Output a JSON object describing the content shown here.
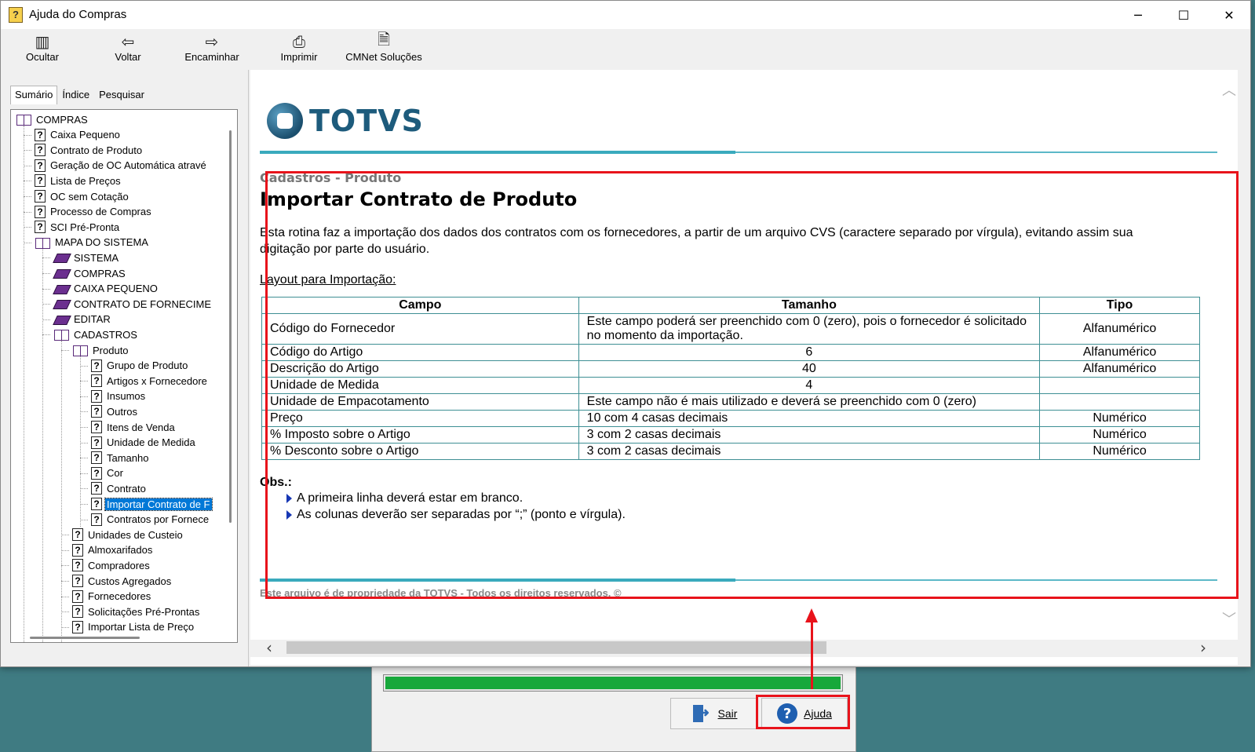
{
  "window": {
    "title": "Ajuda do Compras"
  },
  "window_controls": {
    "minimize": "─",
    "maximize": "☐",
    "close": "✕"
  },
  "toolbar": {
    "hide": "Ocultar",
    "back": "Voltar",
    "forward": "Encaminhar",
    "print": "Imprimir",
    "solutions": "CMNet Soluções"
  },
  "tabs": {
    "summary": "Sumário",
    "index": "Índice",
    "search": "Pesquisar"
  },
  "tree": {
    "root": "COMPRAS",
    "items": [
      "Caixa Pequeno",
      "Contrato de Produto",
      "Geração de OC Automática atravé",
      "Lista de Preços",
      "OC sem Cotação",
      "Processo de Compras",
      "SCI Pré-Pronta"
    ],
    "map": "MAPA DO SISTEMA",
    "map_items": [
      "SISTEMA",
      "COMPRAS",
      "CAIXA PEQUENO",
      "CONTRATO DE FORNECIME",
      "EDITAR"
    ],
    "cadastros": "CADASTROS",
    "produto": "Produto",
    "produto_items": [
      "Grupo de Produto",
      "Artigos x Fornecedore",
      "Insumos",
      "Outros",
      "Itens de Venda",
      "Unidade de Medida",
      "Tamanho",
      "Cor",
      "Contrato",
      "Importar Contrato de F",
      "Contratos por Fornece"
    ],
    "cadastros_items": [
      "Unidades de Custeio",
      "Almoxarifados",
      "Compradores",
      "Custos Agregados",
      "Fornecedores",
      "Solicitações Pré-Prontas",
      "Importar Lista de Preço"
    ]
  },
  "logo": {
    "text": "TOTVS"
  },
  "doc": {
    "breadcrumb": "Cadastros - Produto",
    "title": "Importar Contrato de Produto",
    "intro": "Esta rotina faz a importação dos dados dos contratos com os fornecedores, a partir de um arquivo CVS (caractere separado por vírgula), evitando assim sua digitação por parte do usuário.",
    "layout_label": "Layout para Importação:",
    "table": {
      "headers": [
        "Campo",
        "Tamanho",
        "Tipo"
      ],
      "rows": [
        [
          "Código do Fornecedor",
          "Este campo poderá ser preenchido com 0 (zero), pois o fornecedor é solicitado no momento da importação.",
          "Alfanumérico"
        ],
        [
          "Código do Artigo",
          "6",
          "Alfanumérico"
        ],
        [
          "Descrição do Artigo",
          "40",
          "Alfanumérico"
        ],
        [
          "Unidade de Medida",
          "4",
          ""
        ],
        [
          "Unidade de Empacotamento",
          "Este campo não é mais utilizado e deverá se preenchido com 0 (zero)",
          ""
        ],
        [
          "Preço",
          "10 com 4 casas decimais",
          "Numérico"
        ],
        [
          "% Imposto sobre o Artigo",
          "3 com 2 casas decimais",
          "Numérico"
        ],
        [
          "% Desconto sobre o Artigo",
          "3 com 2 casas decimais",
          "Numérico"
        ]
      ]
    },
    "obs_label": "Obs.:",
    "obs_items": [
      "A primeira linha deverá estar em branco.",
      "As colunas deverão ser separadas por “;” (ponto e vírgula)."
    ],
    "footer": "Este arquivo é de propriedade da TOTVS - Todos os direitos reservados. ©"
  },
  "bg_dialog": {
    "progress": 1.0,
    "progress_color": "#17a83b",
    "exit_label": "Sair",
    "help_label": "Ajuda"
  },
  "colors": {
    "annotation": "#e8131b",
    "teal_rule": "#3aaabd",
    "selection": "#0078d7"
  }
}
